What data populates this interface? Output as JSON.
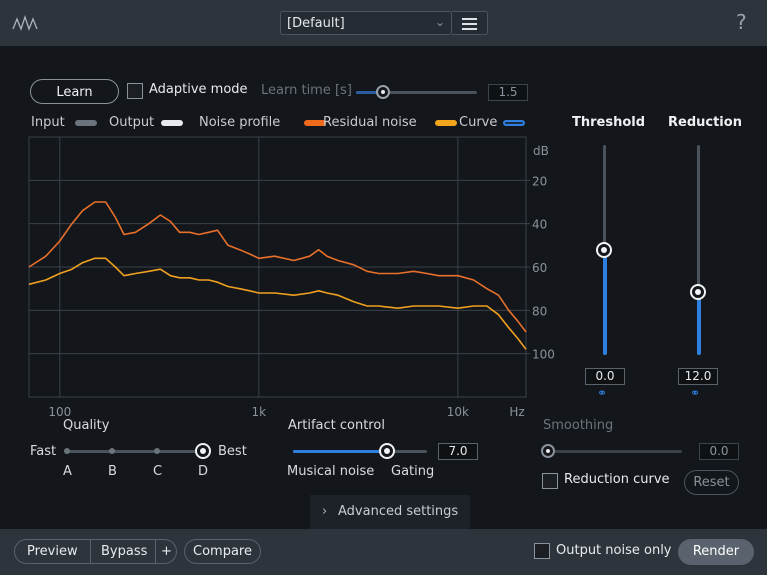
{
  "header": {
    "preset": "[Default]",
    "help": "?"
  },
  "learn": {
    "button": "Learn",
    "adaptive_label": "Adaptive mode",
    "adaptive_checked": false,
    "learn_time_label": "Learn time [s]",
    "learn_time_value": "1.5",
    "learn_time_fraction": 0.22
  },
  "legend": [
    {
      "label": "Input",
      "color": "#6b737c"
    },
    {
      "label": "Output",
      "color": "#e8eaed"
    },
    {
      "label": "Noise profile",
      "color": "#f06a1e"
    },
    {
      "label": "Residual noise",
      "color": "#f3a51c"
    },
    {
      "label": "Curve",
      "color": "#2f7fe0"
    }
  ],
  "chart_data": {
    "type": "line",
    "xlabel": "Hz",
    "ylabel": "dB",
    "x_scale": "log",
    "xlim": [
      70,
      22000
    ],
    "ylim": [
      0,
      120
    ],
    "x_ticks": [
      {
        "value": 100,
        "label": "100"
      },
      {
        "value": 1000,
        "label": "1k"
      },
      {
        "value": 10000,
        "label": "10k"
      }
    ],
    "y_ticks": [
      {
        "value": 20,
        "label": "20"
      },
      {
        "value": 40,
        "label": "40"
      },
      {
        "value": 60,
        "label": "60"
      },
      {
        "value": 80,
        "label": "80"
      },
      {
        "value": 100,
        "label": "100"
      }
    ],
    "y_unit_label": "dB",
    "x_unit_label": "Hz",
    "grid": true,
    "series": [
      {
        "name": "Noise profile",
        "color": "#e8702a",
        "x": [
          70,
          85,
          100,
          115,
          130,
          150,
          170,
          190,
          210,
          240,
          280,
          320,
          360,
          400,
          450,
          500,
          560,
          620,
          700,
          800,
          900,
          1000,
          1200,
          1500,
          1800,
          2000,
          2200,
          2500,
          3000,
          3500,
          4000,
          5000,
          6000,
          7000,
          8000,
          10000,
          12000,
          14000,
          16000,
          18000,
          20000,
          22000
        ],
        "y": [
          60,
          55,
          48,
          40,
          34,
          30,
          30,
          37,
          45,
          44,
          40,
          36,
          39,
          44,
          44,
          45,
          44,
          43,
          50,
          52,
          54,
          56,
          55,
          57,
          55,
          52,
          55,
          57,
          59,
          62,
          63,
          63,
          62,
          63,
          64,
          64,
          66,
          70,
          73,
          80,
          85,
          90
        ]
      },
      {
        "name": "Residual noise",
        "color": "#f0a020",
        "x": [
          70,
          85,
          100,
          115,
          130,
          150,
          170,
          190,
          210,
          240,
          280,
          320,
          360,
          400,
          450,
          500,
          560,
          620,
          700,
          800,
          900,
          1000,
          1200,
          1500,
          1800,
          2000,
          2200,
          2500,
          3000,
          3500,
          4000,
          5000,
          6000,
          7000,
          8000,
          10000,
          12000,
          14000,
          16000,
          18000,
          20000,
          22000
        ],
        "y": [
          68,
          66,
          63,
          61,
          58,
          56,
          56,
          60,
          64,
          63,
          62,
          61,
          64,
          65,
          65,
          66,
          66,
          67,
          69,
          70,
          71,
          72,
          72,
          73,
          72,
          71,
          72,
          73,
          76,
          78,
          78,
          79,
          78,
          78,
          78,
          79,
          78,
          78,
          82,
          88,
          93,
          98
        ]
      }
    ]
  },
  "threshold": {
    "label": "Threshold",
    "value": "0.0",
    "fraction": 0.5
  },
  "reduction": {
    "label": "Reduction",
    "value": "12.0",
    "fraction": 0.3
  },
  "quality": {
    "label": "Quality",
    "fast": "Fast",
    "best": "Best",
    "options": [
      "A",
      "B",
      "C",
      "D"
    ],
    "selected": "D"
  },
  "artifact": {
    "label": "Artifact control",
    "value": "7.0",
    "fraction": 0.7,
    "left_label": "Musical noise",
    "right_label": "Gating"
  },
  "smoothing": {
    "label": "Smoothing",
    "value": "0.0",
    "fraction": 0.0
  },
  "reduction_curve": {
    "label": "Reduction curve",
    "checked": false,
    "reset": "Reset"
  },
  "advanced": {
    "label": "Advanced settings"
  },
  "footer": {
    "preview": "Preview",
    "bypass": "Bypass",
    "plus": "+",
    "compare": "Compare",
    "output_noise_only": "Output noise only",
    "render": "Render"
  }
}
